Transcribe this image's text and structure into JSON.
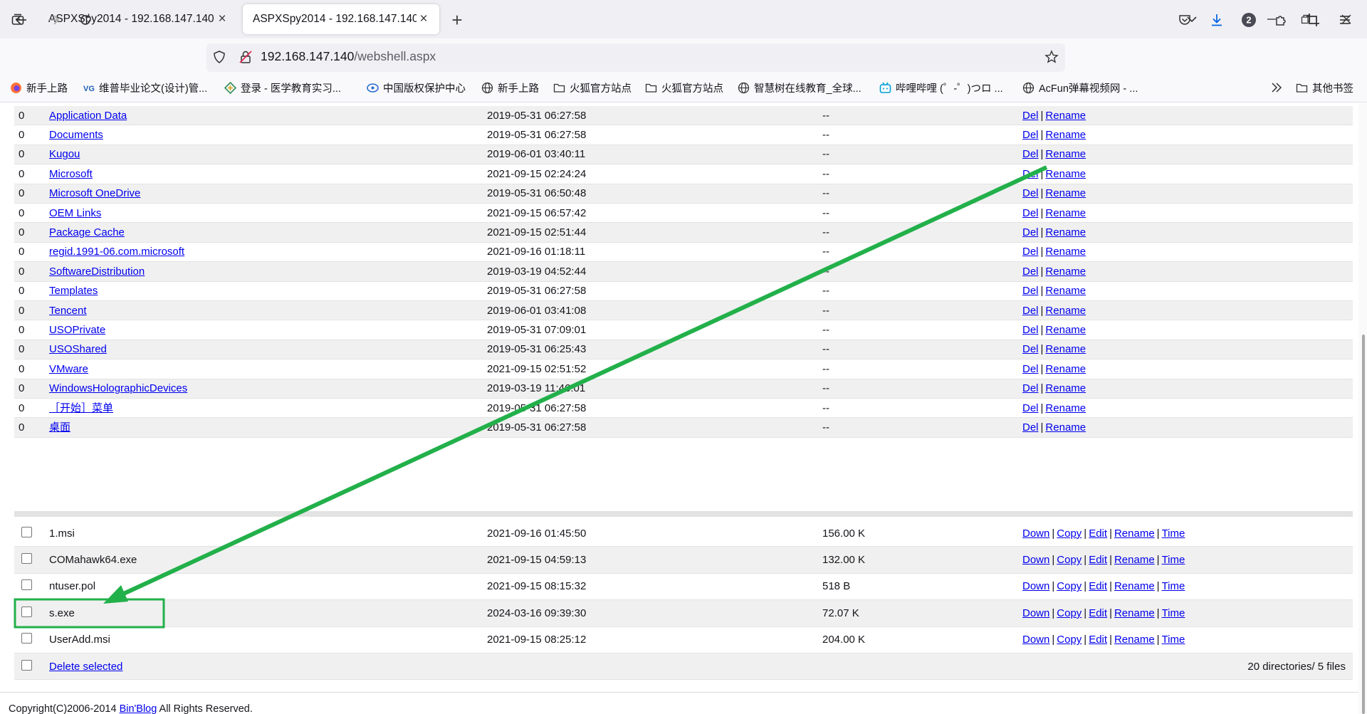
{
  "browser": {
    "tabs": [
      {
        "title": "ASPXSpy2014 - 192.168.147.140",
        "active": false
      },
      {
        "title": "ASPXSpy2014 - 192.168.147.140",
        "active": true
      }
    ],
    "url_host": "192.168.147.140",
    "url_path": "/webshell.aspx",
    "notification_badge": "2",
    "bookmarks": [
      {
        "label": "新手上路",
        "icon": "firefox-icon"
      },
      {
        "label": "维普毕业论文(设计)管...",
        "icon": "vip-icon"
      },
      {
        "label": "登录 - 医学教育实习...",
        "icon": "medical-icon"
      },
      {
        "label": "中国版权保护中心",
        "icon": "copyright-icon"
      },
      {
        "label": "新手上路",
        "icon": "globe-icon"
      },
      {
        "label": "火狐官方站点",
        "icon": "folder-icon"
      },
      {
        "label": "火狐官方站点",
        "icon": "folder-icon"
      },
      {
        "label": "智慧树在线教育_全球...",
        "icon": "globe-icon"
      },
      {
        "label": "哔哩哔哩 (゜-゜)つロ ...",
        "icon": "bilibili-icon"
      },
      {
        "label": "AcFun弹幕视频网 - ...",
        "icon": "globe-icon"
      }
    ],
    "other_bookmarks": "其他书签"
  },
  "directories": [
    {
      "count": "0",
      "name": "Application Data",
      "time": "2019-05-31 06:27:58",
      "size": "--"
    },
    {
      "count": "0",
      "name": "Documents",
      "time": "2019-05-31 06:27:58",
      "size": "--"
    },
    {
      "count": "0",
      "name": "Kugou",
      "time": "2019-06-01 03:40:11",
      "size": "--"
    },
    {
      "count": "0",
      "name": "Microsoft",
      "time": "2021-09-15 02:24:24",
      "size": "--"
    },
    {
      "count": "0",
      "name": "Microsoft OneDrive",
      "time": "2019-05-31 06:50:48",
      "size": "--"
    },
    {
      "count": "0",
      "name": "OEM Links",
      "time": "2021-09-15 06:57:42",
      "size": "--"
    },
    {
      "count": "0",
      "name": "Package Cache",
      "time": "2021-09-15 02:51:44",
      "size": "--"
    },
    {
      "count": "0",
      "name": "regid.1991-06.com.microsoft",
      "time": "2021-09-16 01:18:11",
      "size": "--"
    },
    {
      "count": "0",
      "name": "SoftwareDistribution",
      "time": "2019-03-19 04:52:44",
      "size": "--"
    },
    {
      "count": "0",
      "name": "Templates",
      "time": "2019-05-31 06:27:58",
      "size": "--"
    },
    {
      "count": "0",
      "name": "Tencent",
      "time": "2019-06-01 03:41:08",
      "size": "--"
    },
    {
      "count": "0",
      "name": "USOPrivate",
      "time": "2019-05-31 07:09:01",
      "size": "--"
    },
    {
      "count": "0",
      "name": "USOShared",
      "time": "2019-05-31 06:25:43",
      "size": "--"
    },
    {
      "count": "0",
      "name": "VMware",
      "time": "2021-09-15 02:51:52",
      "size": "--"
    },
    {
      "count": "0",
      "name": "WindowsHolographicDevices",
      "time": "2019-03-19 11:46:01",
      "size": "--"
    },
    {
      "count": "0",
      "name": "［开始］菜单",
      "time": "2019-05-31 06:27:58",
      "size": "--"
    },
    {
      "count": "0",
      "name": "桌面",
      "time": "2019-05-31 06:27:58",
      "size": "--"
    }
  ],
  "dir_actions": {
    "del": "Del",
    "rename": "Rename"
  },
  "files": [
    {
      "name": "1.msi",
      "time": "2021-09-16 01:45:50",
      "size": "156.00 K"
    },
    {
      "name": "COMahawk64.exe",
      "time": "2021-09-15 04:59:13",
      "size": "132.00 K"
    },
    {
      "name": "ntuser.pol",
      "time": "2021-09-15 08:15:32",
      "size": "518 B"
    },
    {
      "name": "s.exe",
      "time": "2024-03-16 09:39:30",
      "size": "72.07 K"
    },
    {
      "name": "UserAdd.msi",
      "time": "2021-09-15 08:25:12",
      "size": "204.00 K"
    }
  ],
  "file_actions": {
    "down": "Down",
    "copy": "Copy",
    "edit": "Edit",
    "rename": "Rename",
    "time": "Time"
  },
  "delete_selected": "Delete selected",
  "summary": "20 directories/ 5 files",
  "footer": {
    "prefix": "Copyright(C)2006-2014 ",
    "link": "Bin'Blog",
    "suffix": " All Rights Reserved."
  },
  "colors": {
    "link": "#0000ee",
    "annotation": "#22b04a",
    "stripe": "#f0f0f0"
  }
}
